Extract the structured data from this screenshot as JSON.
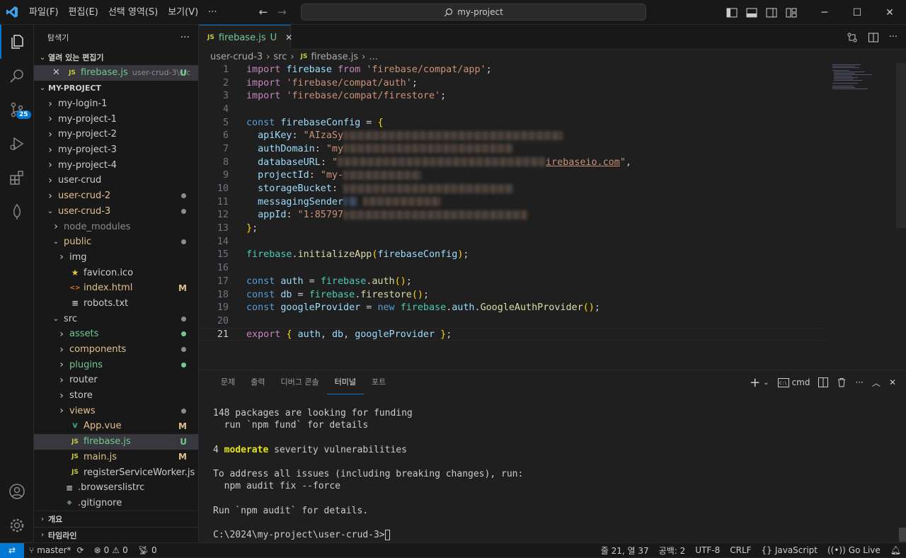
{
  "menu": {
    "items": [
      "파일(F)",
      "편집(E)",
      "선택 영역(S)",
      "보기(V)",
      "···"
    ]
  },
  "search": {
    "text": "my-project"
  },
  "explorer": {
    "title": "탐색기",
    "more": "···",
    "open_editors_label": "열려 있는 편집기",
    "open_editor": {
      "name": "firebase.js",
      "path": "user-crud-3\\src",
      "status": "U"
    },
    "project_label": "MY-PROJECT",
    "tree": [
      {
        "label": "my-login-1",
        "type": "folder",
        "indent": 0,
        "open": false
      },
      {
        "label": "my-project-1",
        "type": "folder",
        "indent": 0,
        "open": false
      },
      {
        "label": "my-project-2",
        "type": "folder",
        "indent": 0,
        "open": false
      },
      {
        "label": "my-project-3",
        "type": "folder",
        "indent": 0,
        "open": false
      },
      {
        "label": "my-project-4",
        "type": "folder",
        "indent": 0,
        "open": false
      },
      {
        "label": "user-crud",
        "type": "folder",
        "indent": 0,
        "open": false
      },
      {
        "label": "user-crud-2",
        "type": "folder",
        "indent": 0,
        "open": false,
        "color": "#e2c08d",
        "dot": "#8c8c8c"
      },
      {
        "label": "user-crud-3",
        "type": "folder",
        "indent": 0,
        "open": true,
        "color": "#e2c08d",
        "dot": "#8c8c8c"
      },
      {
        "label": "node_modules",
        "type": "folder",
        "indent": 1,
        "open": false,
        "color": "#8c8c8c"
      },
      {
        "label": "public",
        "type": "folder",
        "indent": 1,
        "open": true,
        "color": "#e2c08d",
        "dot": "#8c8c8c"
      },
      {
        "label": "img",
        "type": "folder",
        "indent": 2,
        "open": false
      },
      {
        "label": "favicon.ico",
        "type": "file",
        "indent": 2,
        "icon": "star-icon"
      },
      {
        "label": "index.html",
        "type": "file",
        "indent": 2,
        "icon": "html-icon",
        "color": "#e2c08d",
        "deco": "M"
      },
      {
        "label": "robots.txt",
        "type": "file",
        "indent": 2,
        "icon": "lines-icon"
      },
      {
        "label": "src",
        "type": "folder",
        "indent": 1,
        "open": true,
        "dot": "#8c8c8c"
      },
      {
        "label": "assets",
        "type": "folder",
        "indent": 2,
        "open": false,
        "color": "#73c991",
        "dot": "#73c991"
      },
      {
        "label": "components",
        "type": "folder",
        "indent": 2,
        "open": false,
        "color": "#e2c08d",
        "dot": "#8c8c8c"
      },
      {
        "label": "plugins",
        "type": "folder",
        "indent": 2,
        "open": false,
        "color": "#73c991",
        "dot": "#73c991"
      },
      {
        "label": "router",
        "type": "folder",
        "indent": 2,
        "open": false
      },
      {
        "label": "store",
        "type": "folder",
        "indent": 2,
        "open": false
      },
      {
        "label": "views",
        "type": "folder",
        "indent": 2,
        "open": false,
        "color": "#e2c08d",
        "dot": "#8c8c8c"
      },
      {
        "label": "App.vue",
        "type": "file",
        "indent": 2,
        "icon": "vue-icon",
        "color": "#e2c08d",
        "deco": "M"
      },
      {
        "label": "firebase.js",
        "type": "file",
        "indent": 2,
        "icon": "js-icon",
        "color": "#73c991",
        "deco": "U",
        "selected": true
      },
      {
        "label": "main.js",
        "type": "file",
        "indent": 2,
        "icon": "js-icon",
        "color": "#e2c08d",
        "deco": "M"
      },
      {
        "label": "registerServiceWorker.js",
        "type": "file",
        "indent": 2,
        "icon": "js-icon"
      },
      {
        "label": ".browserslistrc",
        "type": "file",
        "indent": 1,
        "icon": "lines-icon"
      },
      {
        "label": ".gitignore",
        "type": "file",
        "indent": 1,
        "icon": "git-icon"
      }
    ],
    "outline_label": "개요",
    "timeline_label": "타임라인"
  },
  "editor": {
    "tab": {
      "name": "firebase.js",
      "status": "U",
      "badge": "JS",
      "close": "✕"
    },
    "breadcrumbs": [
      "user-crud-3",
      "src",
      "firebase.js",
      "..."
    ],
    "line_numbers": [
      "1",
      "2",
      "3",
      "4",
      "5",
      "6",
      "7",
      "8",
      "9",
      "10",
      "11",
      "12",
      "13",
      "14",
      "15",
      "16",
      "17",
      "18",
      "19",
      "20",
      "21"
    ],
    "current_line": "21"
  },
  "panel": {
    "tabs": [
      "문제",
      "출력",
      "디버그 콘솔",
      "터미널",
      "포트"
    ],
    "active_tab": "터미널",
    "shell": "cmd",
    "terminal_lines": [
      "148 packages are looking for funding",
      "  run `npm fund` for details",
      "",
      "4 |moderate| severity vulnerabilities",
      "",
      "To address all issues (including breaking changes), run:",
      "  npm audit fix --force",
      "",
      "Run `npm audit` for details.",
      "",
      "C:\\2024\\my-project\\user-crud-3>"
    ]
  },
  "activity": {
    "scm_badge": "25"
  },
  "status": {
    "branch": "master*",
    "errors": "0",
    "warnings": "0",
    "ports": "0",
    "cursor": "줄 21, 열 37",
    "indent": "공백: 2",
    "encoding": "UTF-8",
    "eol": "CRLF",
    "language": "JavaScript",
    "golive": "Go Live"
  },
  "colors": {
    "accent": "#0078d4",
    "untracked": "#73c991",
    "modified": "#e2c08d",
    "js": "#cbcb41"
  }
}
